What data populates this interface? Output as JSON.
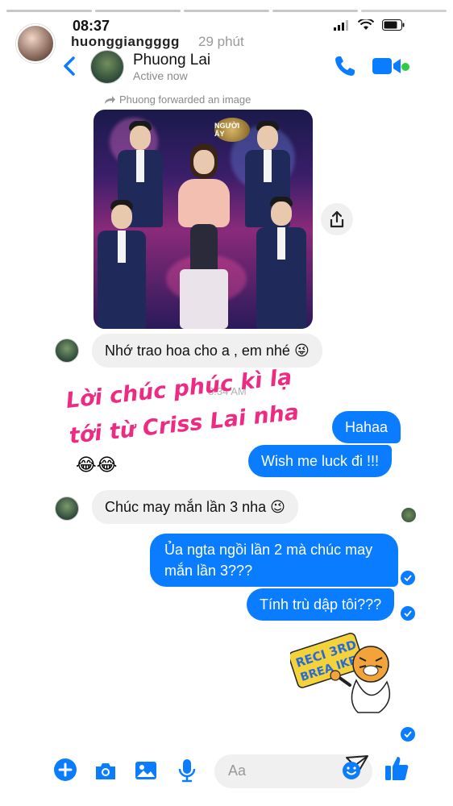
{
  "story": {
    "username": "huonggiangggg",
    "posted_ago": "29 phút"
  },
  "status_bar": {
    "time": "08:37"
  },
  "chat_header": {
    "contact_name": "Phuong Lai",
    "contact_status": "Active now"
  },
  "forward_note": "Phuong forwarded an image",
  "forwarded_image": {
    "logo_text": "NGƯỜI ẤY"
  },
  "messages": [
    {
      "from": "contact",
      "text": "Nhớ trao hoa cho a , em nhé 😜"
    },
    {
      "from": "me",
      "text": "Hahaa"
    },
    {
      "from": "me",
      "text": "Wish me luck đi !!!"
    },
    {
      "from": "contact",
      "text": "Chúc may mắn lần 3 nha 😉"
    },
    {
      "from": "me",
      "text": "Ủa ngta ngồi lần 2 mà chúc may mắn lần 3???"
    },
    {
      "from": "me",
      "text": "Tính trù dập tôi???"
    }
  ],
  "overlay": {
    "line1": "Lời chúc phúc kì lạ",
    "line2": "tới từ Criss Lai nha",
    "emoji": "😂😂",
    "ghost_time": "8:34 AM"
  },
  "sticker": {
    "text_line1": "RECI 3RD",
    "text_line2": "BREA IKER"
  },
  "compose": {
    "placeholder": "Aa"
  },
  "colors": {
    "messenger_blue": "#0a7cff",
    "overlay_pink": "#ee2b83",
    "incoming_bubble": "#f0f0f0"
  },
  "icons": [
    "back-icon",
    "phone-icon",
    "video-camera-icon",
    "forward-arrow-icon",
    "share-icon",
    "plus-icon",
    "camera-icon",
    "gallery-icon",
    "microphone-icon",
    "emoji-icon",
    "like-icon",
    "story-send-icon"
  ]
}
